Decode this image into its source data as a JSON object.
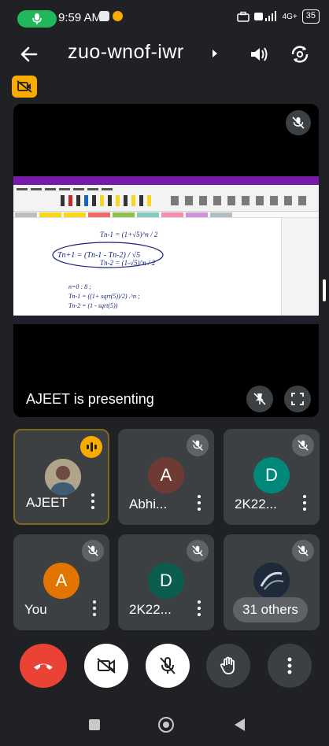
{
  "status_bar": {
    "time": "9:59 AM",
    "network_label": "4G+",
    "battery": "35"
  },
  "header": {
    "title": "zuo-wnof-iwr"
  },
  "presentation": {
    "presenter_label": "AJEET is presenting",
    "handwriting": {
      "l1": "Tn-1 = (1+√5)^n / 2",
      "l2": "Tn-2 = (1-√5)^n / 2",
      "box": "Tn+1 = (Tn-1 - Tn-2) / √5",
      "c1": "n=0 : 8 ;",
      "c2": "Tn-1 = ((1+ sqrt(5))/2) .^n ;",
      "c3": "Tn-2 = (1 - sqrt(5))"
    }
  },
  "participants": [
    {
      "name": "AJEET",
      "initial": "",
      "avatar_color": "#8a9ba8",
      "state": "speaking",
      "avatar": "photo"
    },
    {
      "name": "Abhi...",
      "initial": "A",
      "avatar_color": "#6d3a34",
      "state": "muted"
    },
    {
      "name": "2K22...",
      "initial": "D",
      "avatar_color": "#00897b",
      "state": "muted"
    },
    {
      "name": "You",
      "initial": "A",
      "avatar_color": "#e37400",
      "state": "muted"
    },
    {
      "name": "2K22...",
      "initial": "D",
      "avatar_color": "#0b5d4e",
      "state": "muted"
    },
    {
      "name": "31 others",
      "initial": "",
      "avatar_color": "#1e2a3a",
      "state": "muted",
      "avatar": "photo"
    }
  ],
  "colors": {
    "accent_green": "#1fb85a",
    "end_call": "#ea4335",
    "warning": "#f9ab00",
    "tile_bg": "#3c4043"
  },
  "icons": [
    "back-arrow-icon",
    "speaker-icon",
    "flip-camera-icon",
    "no-camera-icon",
    "mic-off-icon",
    "pin-off-icon",
    "fullscreen-icon",
    "end-call-icon",
    "camera-off-icon",
    "hand-icon",
    "more-vert-icon"
  ]
}
